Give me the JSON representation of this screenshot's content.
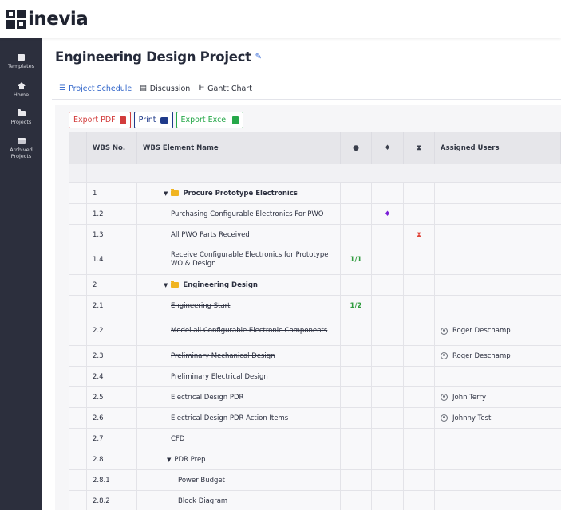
{
  "app": {
    "logo_text": "inevia"
  },
  "sidebar": {
    "items": [
      {
        "label": "Templates",
        "icon": "templates-icon"
      },
      {
        "label": "Home",
        "icon": "home-icon"
      },
      {
        "label": "Projects",
        "icon": "folder-icon"
      },
      {
        "label": "Archived Projects",
        "icon": "archive-icon"
      }
    ]
  },
  "page": {
    "title": "Engineering Design Project"
  },
  "tabs": [
    {
      "label": "Project Schedule",
      "icon": "list-icon",
      "active": true
    },
    {
      "label": "Discussion",
      "icon": "comment-icon"
    },
    {
      "label": "Gantt Chart",
      "icon": "gantt-icon"
    }
  ],
  "toolbar": {
    "export_pdf": "Export PDF",
    "print": "Print",
    "export_excel": "Export Excel"
  },
  "table": {
    "headers": {
      "wbs_no": "WBS No.",
      "name": "WBS Element Name",
      "assigned": "Assigned Users"
    },
    "rows": [
      {
        "wbs": "1",
        "name": "Procure Prototype Electronics",
        "progress": "",
        "user": ""
      },
      {
        "wbs": "1.2",
        "name": "Purchasing Configurable Electronics For PWO",
        "progress": "",
        "user": ""
      },
      {
        "wbs": "1.3",
        "name": "All PWO Parts Received",
        "progress": "",
        "user": ""
      },
      {
        "wbs": "1.4",
        "name": "Receive Configurable Electronics for Prototype WO & Design",
        "progress": "1/1",
        "user": ""
      },
      {
        "wbs": "2",
        "name": "Engineering Design",
        "progress": "",
        "user": ""
      },
      {
        "wbs": "2.1",
        "name": "Engineering Start",
        "progress": "1/2",
        "user": ""
      },
      {
        "wbs": "2.2",
        "name": "Model all Configurable Electronic Components",
        "progress": "",
        "user": "Roger Deschamp"
      },
      {
        "wbs": "2.3",
        "name": "Preliminary Mechanical Design",
        "progress": "",
        "user": "Roger Deschamp"
      },
      {
        "wbs": "2.4",
        "name": "Preliminary Electrical Design",
        "progress": "",
        "user": ""
      },
      {
        "wbs": "2.5",
        "name": "Electrical Design PDR",
        "progress": "",
        "user": "John Terry"
      },
      {
        "wbs": "2.6",
        "name": "Electrical Design PDR Action Items",
        "progress": "",
        "user": "Johnny Test"
      },
      {
        "wbs": "2.7",
        "name": "CFD",
        "progress": "",
        "user": ""
      },
      {
        "wbs": "2.8",
        "name": "PDR Prep",
        "progress": "",
        "user": ""
      },
      {
        "wbs": "2.8.1",
        "name": "Power Budget",
        "progress": "",
        "user": ""
      },
      {
        "wbs": "2.8.2",
        "name": "Block Diagram",
        "progress": "",
        "user": ""
      }
    ]
  },
  "colors": {
    "sidebar_bg": "#2c2f3d",
    "accent": "#2e63c9",
    "pdf": "#d23c3c",
    "print": "#1f3a8a",
    "excel": "#27a84a",
    "milestone": "#7b1fd8"
  }
}
